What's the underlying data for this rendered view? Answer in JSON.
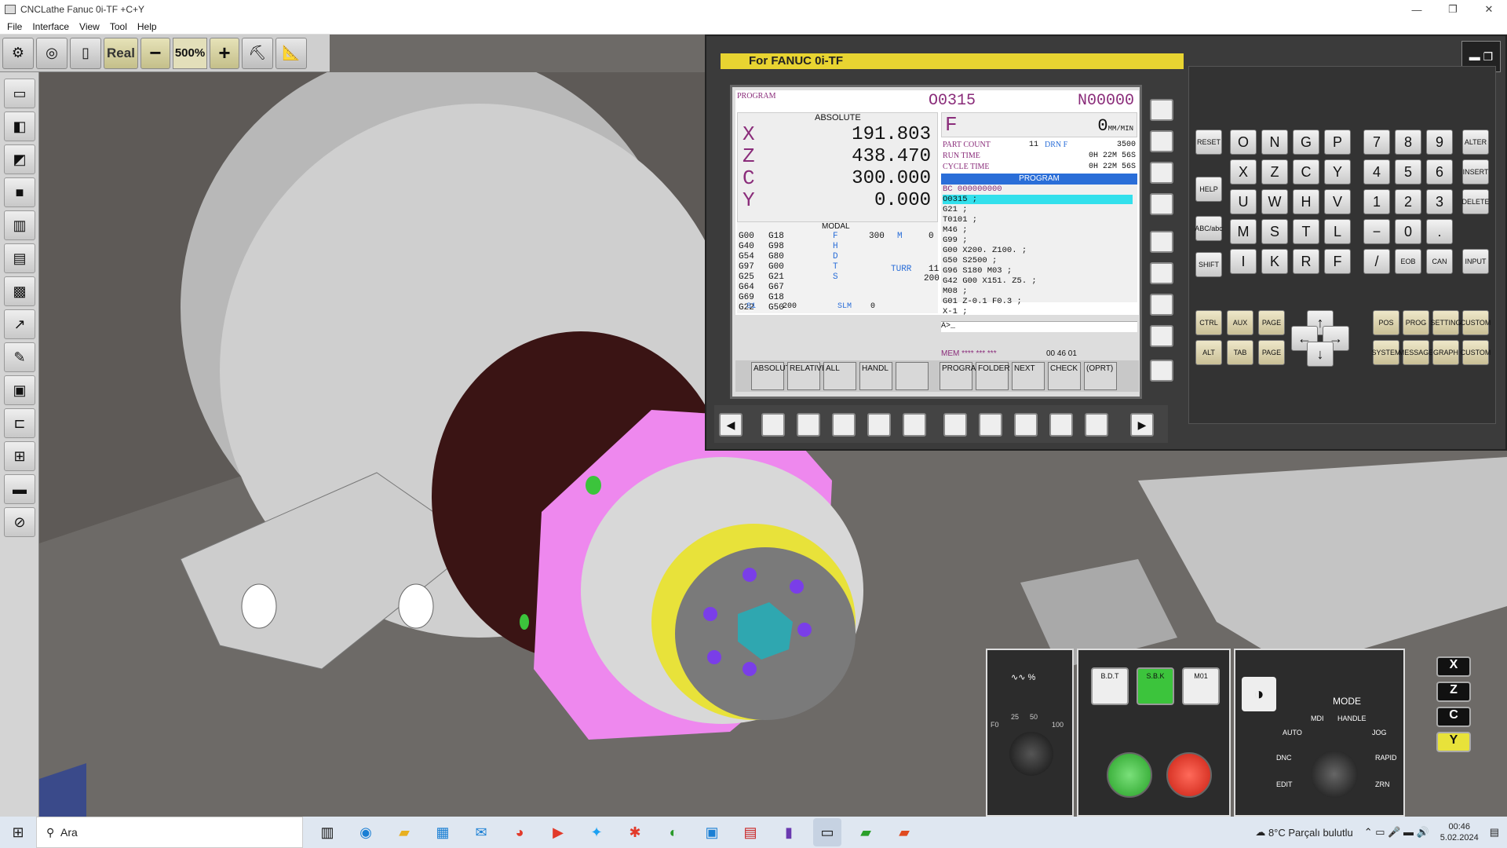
{
  "window": {
    "title": "CNCLathe Fanuc 0i-TF +C+Y",
    "min": "—",
    "max": "❐",
    "close": "✕"
  },
  "menu": [
    "File",
    "Interface",
    "View",
    "Tool",
    "Help"
  ],
  "toolbar": {
    "real": "Real",
    "minus": "−",
    "zoom": "500%",
    "plus": "+"
  },
  "cnc": {
    "title": "For FANUC 0i-TF",
    "screen_header": "PROGRAM",
    "o_number": "O0315",
    "n_number": "N00000",
    "abs_label": "ABSOLUTE",
    "axes": [
      {
        "name": "X",
        "value": "191.803"
      },
      {
        "name": "Z",
        "value": "438.470"
      },
      {
        "name": "C",
        "value": "300.000"
      },
      {
        "name": "Y",
        "value": "0.000"
      }
    ],
    "modal_label": "MODAL",
    "modal_col1": [
      "G00",
      "G40",
      "G54",
      "G97",
      "G25",
      "G64",
      "G69",
      "G22"
    ],
    "modal_col2": [
      "G18",
      "G98",
      "G80",
      "G00",
      "G21",
      "G67",
      "G18",
      "G50"
    ],
    "modal_letters": [
      "F",
      "H",
      "D",
      "T",
      "S"
    ],
    "f_modal": "300",
    "m_label": "M",
    "m_val": "0",
    "turr": "TURR",
    "turr_val": "11",
    "s_val": "200",
    "s1_label": "S1",
    "s1_val": "200",
    "slm_label": "SLM",
    "slm_val": "0",
    "f_label": "F",
    "f_value": "0",
    "f_unit": "MM/MIN",
    "part_count_label": "PART COUNT",
    "part_count": "11",
    "drn_label": "DRN F",
    "drn_val": "3500",
    "run_time_label": "RUN TIME",
    "run_time": "0H  22M  56S",
    "cycle_time_label": "CYCLE TIME",
    "cycle_time": "0H  22M  56S",
    "program_bar": "PROGRAM",
    "program_lines": [
      "BC 000000000",
      "O0315 ;",
      "G21 ;",
      "T0101 ;",
      "M46 ;",
      "G99 ;",
      "G00 X200. Z100. ;",
      "G50 S2500 ;",
      "G96 S180 M03 ;",
      "G42 G00 X151. Z5. ;",
      "M08 ;",
      "G01 Z-0.1 F0.3 ;",
      "X-1 ;"
    ],
    "input_line": "A>_",
    "mem_line": "MEM **** *** ***",
    "clock": "00 46 01",
    "softkeys": [
      "ABSOLUTE",
      "RELATIVE",
      "ALL",
      "HANDL",
      "",
      "PROGRAM",
      "FOLDER",
      "NEXT",
      "CHECK",
      "(OPRT)"
    ],
    "arrow_left": "◀",
    "arrow_right": "▶"
  },
  "keypad": {
    "reset": "RESET",
    "help": "HELP",
    "abc": "ABC/abc",
    "shift": "SHIFT",
    "ctrl": "CTRL",
    "alt": "ALT",
    "aux": "AUX",
    "tab": "TAB",
    "page_up": "PAGE",
    "page_down": "PAGE",
    "letters": [
      "O",
      "N",
      "G",
      "P",
      "X",
      "Z",
      "C",
      "Y",
      "U",
      "W",
      "H",
      "V",
      "M",
      "S",
      "T",
      "L",
      "I",
      "K",
      "R",
      "F"
    ],
    "nums": [
      "7",
      "8",
      "9",
      "4",
      "5",
      "6",
      "1",
      "2",
      "3",
      "−",
      "0",
      "."
    ],
    "eob": "EOB",
    "slash": "/",
    "can": "CAN",
    "input": "INPUT",
    "alter": "ALTER",
    "insert": "INSERT",
    "delete": "DELETE",
    "func": [
      "POS",
      "PROG",
      "SETTING",
      "CUSTOM",
      "SYSTEM",
      "MESSAGE",
      "GRAPH",
      "CUSTOM"
    ]
  },
  "panel": {
    "feed_label": "∿∿ %",
    "feed_ticks": [
      "F0",
      "25",
      "50",
      "100"
    ],
    "bdt": "B.D.T",
    "sbk": "S.B.K",
    "m01": "M01",
    "mode_label": "MODE",
    "mode_items": [
      "AUTO",
      "MDI",
      "HANDLE",
      "JOG",
      "DNC",
      "RAPID",
      "EDIT",
      "ZRN"
    ],
    "axis_sel": [
      "X",
      "Z",
      "C",
      "Y"
    ]
  },
  "taskbar": {
    "search": "Ara",
    "weather": "8°C  Parçalı bulutlu",
    "time": "00:46",
    "date": "5.02.2024"
  },
  "colors": {
    "pink": "#ee88ee",
    "yellow": "#e8d431",
    "cyan": "#33e0ec",
    "green": "#3cc43c",
    "red": "#e23a2a"
  }
}
